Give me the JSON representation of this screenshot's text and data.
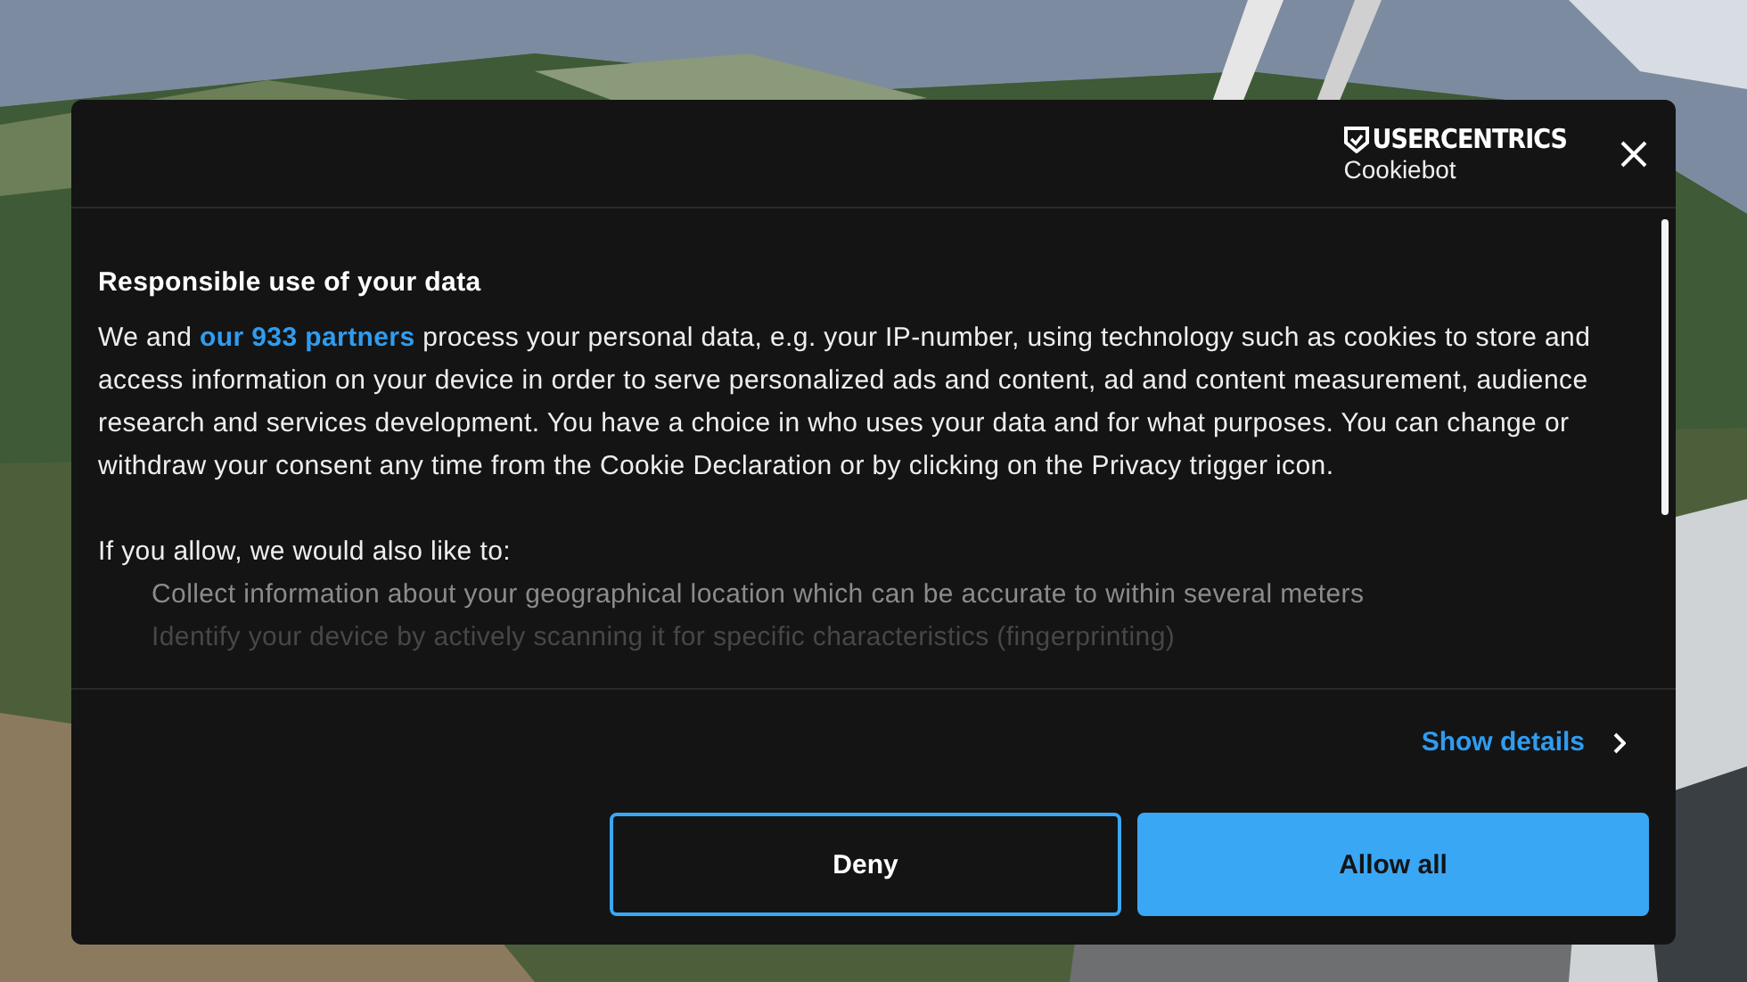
{
  "dialog": {
    "logo": {
      "brand": "USERCENTRICS",
      "product": "Cookiebot"
    },
    "title": "Responsible use of your data",
    "intro": {
      "before": "We and ",
      "link": "our 933 partners",
      "after": " process your personal data, e.g. your IP-number, using technology such as cookies to store and access information on your device in order to serve personalized ads and content, ad and content measurement, audience research and services development. You have a choice in who uses your data and for what purposes. You can change or withdraw your consent any time from the Cookie Declaration or by clicking on the Privacy trigger icon."
    },
    "also_like": "If you allow, we would also like to:",
    "purposes": [
      "Collect information about your geographical location which can be accurate to within several meters",
      "Identify your device by actively scanning it for specific characteristics (fingerprinting)"
    ],
    "show_details": "Show details",
    "buttons": [
      {
        "label": "Deny",
        "kind": "outline"
      },
      {
        "label": "Allow all",
        "kind": "primary"
      }
    ]
  }
}
